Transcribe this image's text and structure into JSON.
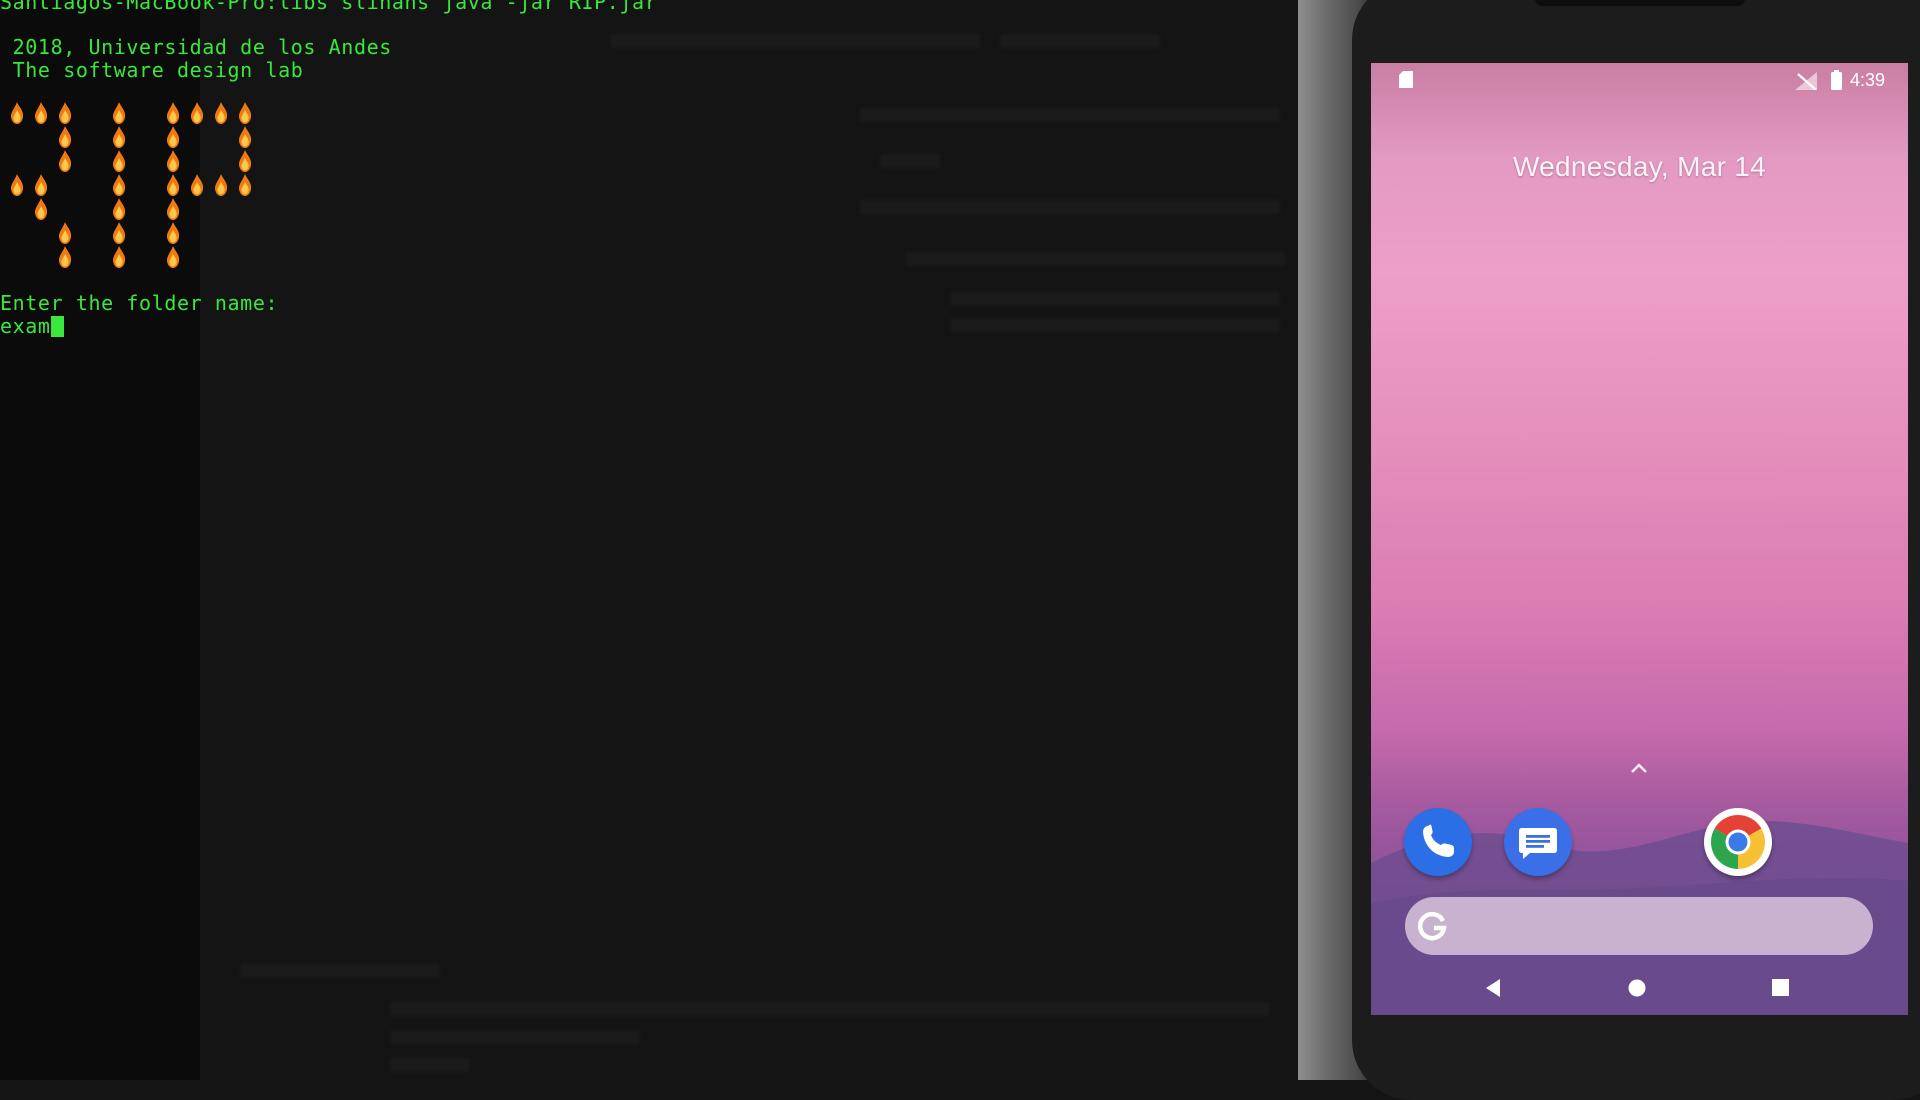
{
  "terminal": {
    "command_line": "Santiagos-MacBook-Pro:libs slinans java -jar RIP.jar",
    "copyright_line": " 2018, Universidad de los Andes",
    "lab_line": " The software design lab",
    "banner_text": "RIP",
    "prompt_label": "Enter the folder name:",
    "input_value": "exam",
    "text_color": "#39e83a"
  },
  "phone": {
    "status_bar": {
      "time": "4:39"
    },
    "lock_date": "Wednesday, Mar 14",
    "dock": [
      {
        "name": "phone-app-icon"
      },
      {
        "name": "messages-app-icon"
      },
      {
        "name": "chrome-app-icon"
      }
    ],
    "search_bar": {
      "icon": "google-g-icon"
    },
    "nav": {
      "back": "back-icon",
      "home": "home-icon",
      "recents": "recents-icon"
    }
  }
}
